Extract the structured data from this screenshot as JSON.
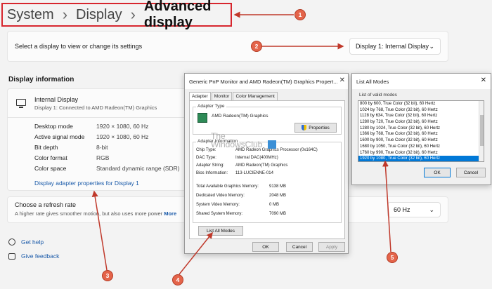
{
  "breadcrumb": {
    "root": "System",
    "parent": "Display",
    "current": "Advanced display",
    "sep": "›"
  },
  "select_display": {
    "prompt": "Select a display to view or change its settings",
    "value": "Display 1: Internal Display"
  },
  "display_info": {
    "title": "Display information",
    "name": "Internal Display",
    "connection": "Display 1: Connected to AMD Radeon(TM) Graphics",
    "rows": [
      {
        "label": "Desktop mode",
        "value": "1920 × 1080, 60 Hz"
      },
      {
        "label": "Active signal mode",
        "value": "1920 × 1080, 60 Hz"
      },
      {
        "label": "Bit depth",
        "value": "8-bit"
      },
      {
        "label": "Color format",
        "value": "RGB"
      },
      {
        "label": "Color space",
        "value": "Standard dynamic range (SDR)"
      }
    ],
    "adapter_link": "Display adapter properties for Display 1"
  },
  "refresh": {
    "title": "Choose a refresh rate",
    "subtitle": "A higher rate gives smoother motion, but also uses more power",
    "more": "More",
    "value": "60 Hz"
  },
  "help": {
    "get_help": "Get help",
    "feedback": "Give feedback"
  },
  "props_dialog": {
    "title": "Generic PnP Monitor and AMD Radeon(TM) Graphics Propert...",
    "tabs": [
      "Adapter",
      "Monitor",
      "Color Management"
    ],
    "adapter_type_label": "Adapter Type",
    "adapter_name": "AMD Radeon(TM) Graphics",
    "properties_btn": "Properties",
    "adapter_info_label": "Adapter Information",
    "info": [
      {
        "label": "Chip Type:",
        "value": "AMD Radeon Graphics Processor (0x164C)"
      },
      {
        "label": "DAC Type:",
        "value": "Internal DAC(400MHz)"
      },
      {
        "label": "Adapter String:",
        "value": "AMD Radeon(TM) Graphics"
      },
      {
        "label": "Bios Information:",
        "value": "113-LUCIENNE-014"
      }
    ],
    "memory": [
      {
        "label": "Total Available Graphics Memory:",
        "value": "9138 MB"
      },
      {
        "label": "Dedicated Video Memory:",
        "value": "2048 MB"
      },
      {
        "label": "System Video Memory:",
        "value": "0 MB"
      },
      {
        "label": "Shared System Memory:",
        "value": "7090 MB"
      }
    ],
    "list_all_modes_btn": "List All Modes",
    "ok": "OK",
    "cancel": "Cancel",
    "apply": "Apply"
  },
  "watermark": {
    "line1": "The",
    "line2": "WindowsClub"
  },
  "modes_dialog": {
    "title": "List All Modes",
    "caption": "List of valid modes",
    "modes": [
      "800 by 600, True Color (32 bit), 60 Hertz",
      "1024 by 768, True Color (32 bit), 60 Hertz",
      "1128 by 634, True Color (32 bit), 60 Hertz",
      "1280 by 720, True Color (32 bit), 60 Hertz",
      "1280 by 1024, True Color (32 bit), 60 Hertz",
      "1366 by 768, True Color (32 bit), 60 Hertz",
      "1600 by 900, True Color (32 bit), 60 Hertz",
      "1680 by 1050, True Color (32 bit), 60 Hertz",
      "1760 by 990, True Color (32 bit), 60 Hertz",
      "1920 by 1080, True Color (32 bit), 60 Hertz"
    ],
    "selected_index": 9,
    "ok": "OK",
    "cancel": "Cancel"
  },
  "callouts": [
    "1",
    "2",
    "3",
    "4",
    "5"
  ],
  "colors": {
    "callout": "#e4644a",
    "highlight_box": "#d7262e",
    "link": "#1a5aa9",
    "selection": "#0078d7"
  }
}
